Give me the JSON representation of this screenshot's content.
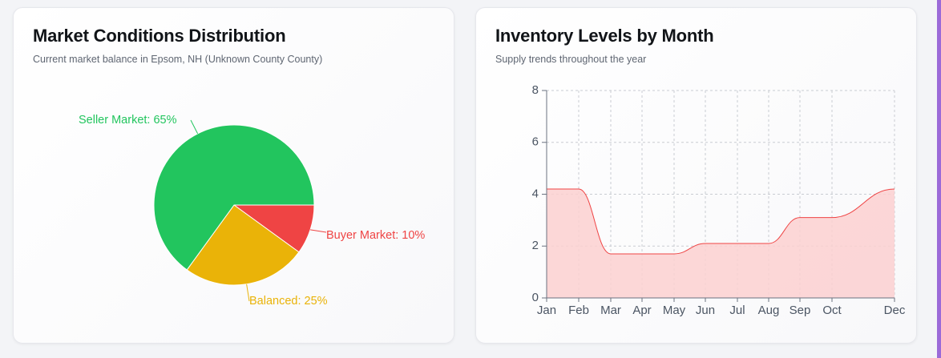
{
  "left_card": {
    "title": "Market Conditions Distribution",
    "subtitle": "Current market balance in Epsom, NH (Unknown County County)"
  },
  "right_card": {
    "title": "Inventory Levels by Month",
    "subtitle": "Supply trends throughout the year"
  },
  "chart_data": [
    {
      "type": "pie",
      "labels": [
        "Seller Market: 65%",
        "Balanced: 25%",
        "Buyer Market: 10%"
      ],
      "categories": [
        "Seller Market",
        "Balanced",
        "Buyer Market"
      ],
      "values": [
        65,
        25,
        10
      ],
      "colors": [
        "#22c55e",
        "#eab308",
        "#ef4444"
      ]
    },
    {
      "type": "area",
      "categories": [
        "Jan",
        "Feb",
        "Mar",
        "Apr",
        "May",
        "Jun",
        "Jul",
        "Aug",
        "Sep",
        "Oct",
        "Dec"
      ],
      "values": [
        4.2,
        4.2,
        1.7,
        1.7,
        1.7,
        2.1,
        2.1,
        2.1,
        3.1,
        3.1,
        4.2
      ],
      "ylim": [
        0,
        8
      ],
      "yticks": [
        "0",
        "2",
        "4",
        "6",
        "8"
      ],
      "grid": true,
      "line_color": "#ef4444",
      "fill_color": "#fbd0d0"
    }
  ]
}
